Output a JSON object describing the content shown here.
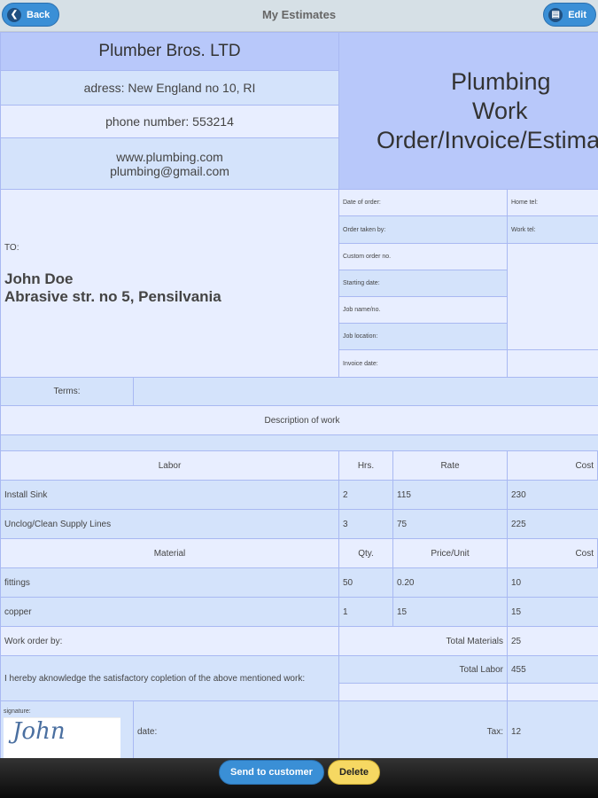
{
  "header": {
    "title": "My Estimates",
    "back": "Back",
    "edit": "Edit"
  },
  "company": {
    "name": "Plumber Bros. LTD",
    "address": "adress: New England no 10, RI",
    "phone": "phone number: 553214",
    "web": "www.plumbing.com",
    "email": "plumbing@gmail.com"
  },
  "doc_title": [
    "Plumbing",
    "Work",
    "Order/Invoice/Estimate"
  ],
  "to": {
    "label": "TO:",
    "name": "John Doe",
    "address": "Abrasive str. no 5, Pensilvania"
  },
  "fields": [
    "Date of order:",
    "Order taken by:",
    "Custom order no.",
    "Starting date:",
    "Job name/no.",
    "Job location:",
    "Invoice date:"
  ],
  "tels": [
    "Home tel:",
    "Work tel:"
  ],
  "terms": "Terms:",
  "description": "Description of work",
  "labor": {
    "headers": [
      "Labor",
      "Hrs.",
      "Rate",
      "Cost"
    ],
    "rows": [
      [
        "Install Sink",
        "2",
        "115",
        "230"
      ],
      [
        "Unclog/Clean Supply Lines",
        "3",
        "75",
        "225"
      ]
    ]
  },
  "material": {
    "headers": [
      "Material",
      "Qty.",
      "Price/Unit",
      "Cost"
    ],
    "rows": [
      [
        "fittings",
        "50",
        "0.20",
        "10"
      ],
      [
        "copper",
        "1",
        "15",
        "15"
      ]
    ]
  },
  "work_order_by": "Work order by:",
  "acknowledge": "I hereby aknowledge the satisfactory copletion of the above mentioned work:",
  "totals": {
    "materials_label": "Total Materials",
    "materials": "25",
    "labor_label": "Total Labor",
    "labor": "455",
    "tax_label": "Tax:",
    "tax": "12"
  },
  "signature_label": "signature:",
  "signature_text": "John",
  "date_label": "date:",
  "actions": {
    "send": "Send to customer",
    "delete": "Delete"
  }
}
